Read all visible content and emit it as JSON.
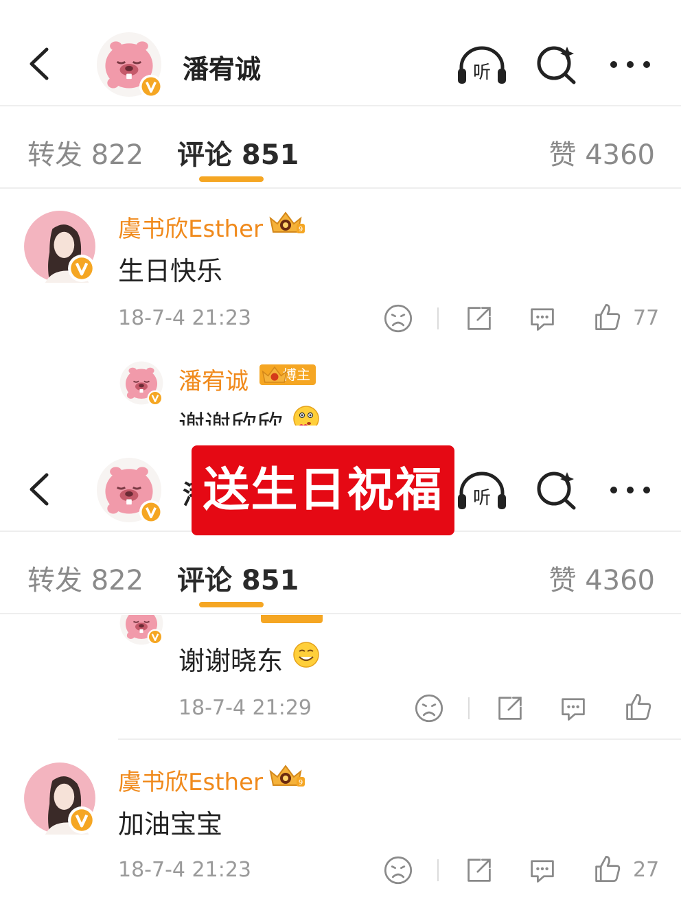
{
  "header": {
    "title": "潘宥诚",
    "listen_label": "听"
  },
  "tabs": {
    "repost": "转发 822",
    "comment": "评论 851",
    "like": "赞 4360"
  },
  "comment1": {
    "user": "虞书欣Esther",
    "text": "生日快乐",
    "time": "18-7-4 21:23",
    "likes": "77"
  },
  "reply1": {
    "user": "潘宥诚",
    "badge": "博主",
    "text": "谢谢欣欣"
  },
  "banner": {
    "text": "送生日祝福"
  },
  "reply2": {
    "text": "谢谢晓东",
    "time": "18-7-4 21:29"
  },
  "comment2": {
    "user": "虞书欣Esther",
    "text": "加油宝宝",
    "time": "18-7-4 21:23",
    "likes": "27"
  },
  "colors": {
    "accent": "#f5a623",
    "username": "#f08a1c",
    "banner": "#e50914",
    "avatar_pink": "#f4a3b4"
  }
}
